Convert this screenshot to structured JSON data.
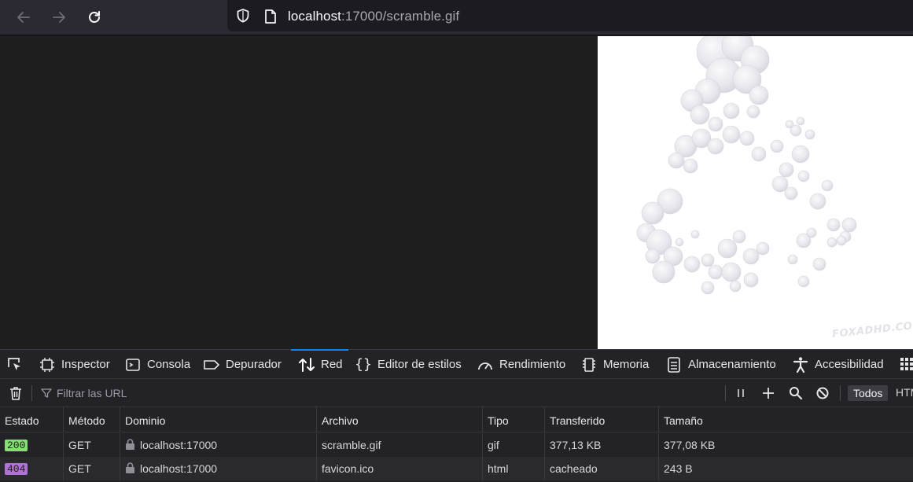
{
  "browser": {
    "url_host": "localhost",
    "url_rest": ":17000/scramble.gif",
    "icons": [
      "back-arrow-icon",
      "forward-arrow-icon",
      "reload-icon",
      "shield-icon",
      "page-icon"
    ]
  },
  "page": {
    "watermark": "FOXADHD.COM"
  },
  "devtools": {
    "tabs": [
      {
        "label": "Inspector",
        "icon": "inspector-icon"
      },
      {
        "label": "Consola",
        "icon": "console-icon"
      },
      {
        "label": "Depurador",
        "icon": "debugger-icon"
      },
      {
        "label": "Red",
        "icon": "network-arrows-icon",
        "active": true
      },
      {
        "label": "Editor de estilos",
        "icon": "braces-icon"
      },
      {
        "label": "Rendimiento",
        "icon": "gauge-icon"
      },
      {
        "label": "Memoria",
        "icon": "chip-icon"
      },
      {
        "label": "Almacenamiento",
        "icon": "storage-icon"
      },
      {
        "label": "Accesibilidad",
        "icon": "accessibility-icon"
      }
    ],
    "filter_placeholder": "Filtrar las URL",
    "todos_label": "Todos",
    "html_label": "HTML",
    "accent": "#0a84ff"
  },
  "network": {
    "columns": [
      "Estado",
      "Método",
      "Dominio",
      "Archivo",
      "Tipo",
      "Transferido",
      "Tamaño"
    ],
    "rows": [
      {
        "status": "200",
        "method": "GET",
        "domain": "localhost:17000",
        "file": "scramble.gif",
        "type": "gif",
        "transferred": "377,13 KB",
        "size": "377,08 KB",
        "status_color": "#86de74"
      },
      {
        "status": "404",
        "method": "GET",
        "domain": "localhost:17000",
        "file": "favicon.ico",
        "type": "html",
        "transferred": "cacheado",
        "size": "243 B",
        "status_color": "#b072d6"
      }
    ]
  }
}
